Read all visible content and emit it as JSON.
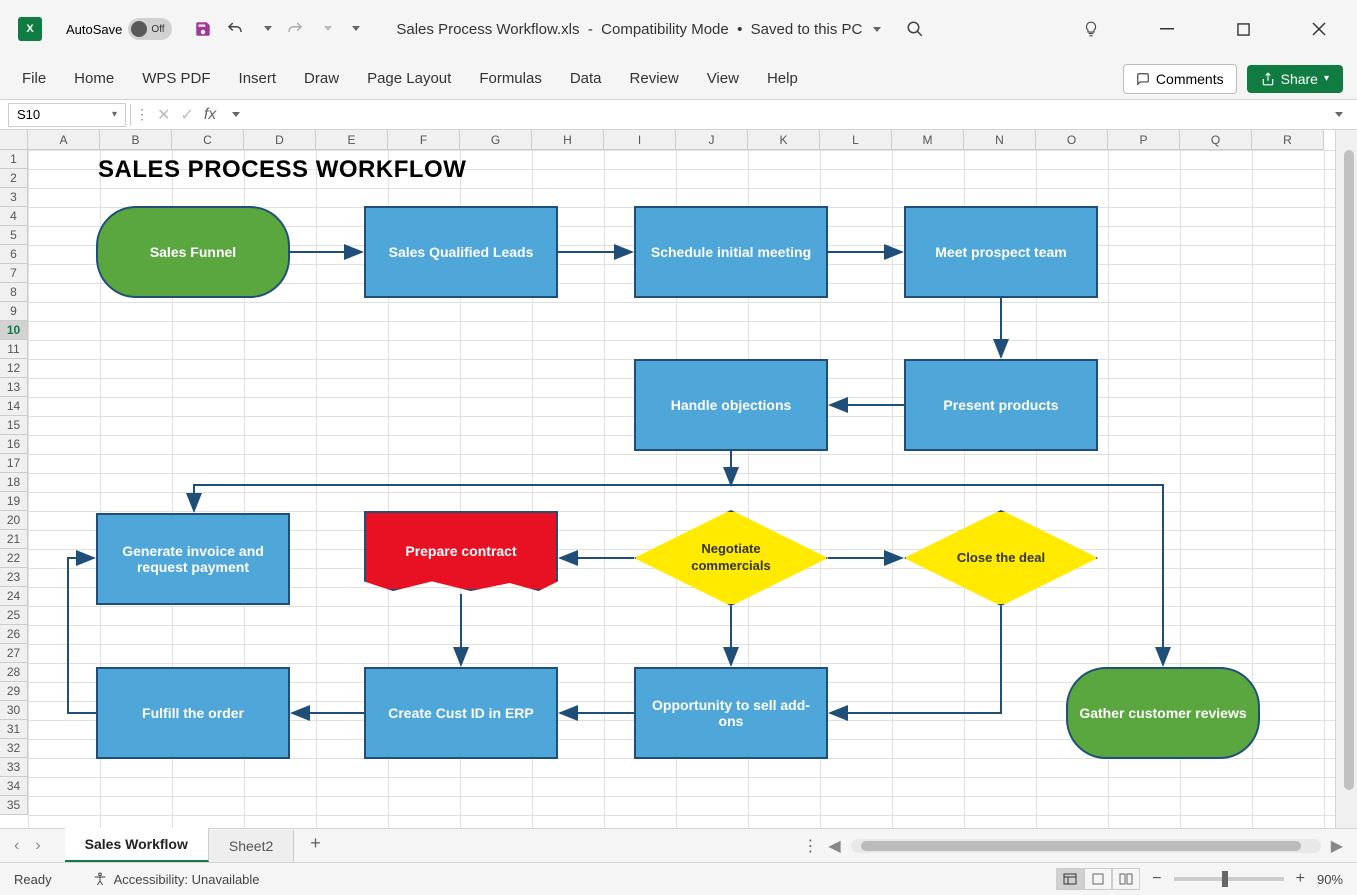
{
  "titlebar": {
    "autosave_label": "AutoSave",
    "autosave_state": "Off",
    "filename": "Sales Process Workflow.xls",
    "mode": "Compatibility Mode",
    "saved": "Saved to this PC"
  },
  "ribbon": {
    "tabs": [
      "File",
      "Home",
      "WPS PDF",
      "Insert",
      "Draw",
      "Page Layout",
      "Formulas",
      "Data",
      "Review",
      "View",
      "Help"
    ],
    "comments": "Comments",
    "share": "Share"
  },
  "formula_bar": {
    "cell_ref": "S10"
  },
  "columns": [
    "A",
    "B",
    "C",
    "D",
    "E",
    "F",
    "G",
    "H",
    "I",
    "J",
    "K",
    "L",
    "M",
    "N",
    "O",
    "P",
    "Q",
    "R"
  ],
  "rows_count": 35,
  "active_row": 10,
  "diagram": {
    "title": "SALES PROCESS WORKFLOW",
    "shapes": {
      "sales_funnel": "Sales Funnel",
      "sql": "Sales Qualified Leads",
      "schedule": "Schedule initial meeting",
      "meet": "Meet prospect team",
      "present": "Present products",
      "handle": "Handle objections",
      "negotiate": "Negotiate commercials",
      "close": "Close the deal",
      "contract": "Prepare contract",
      "invoice": "Generate invoice and request payment",
      "cust_id": "Create Cust ID in ERP",
      "addons": "Opportunity to sell add-ons",
      "fulfill": "Fulfill the order",
      "reviews": "Gather customer reviews"
    }
  },
  "sheets": {
    "active": "Sales Workflow",
    "other": "Sheet2"
  },
  "status": {
    "state": "Ready",
    "accessibility": "Accessibility: Unavailable",
    "zoom": "90%"
  },
  "chart_data": {
    "type": "flowchart",
    "title": "SALES PROCESS WORKFLOW",
    "nodes": [
      {
        "id": "sales_funnel",
        "label": "Sales Funnel",
        "type": "terminator"
      },
      {
        "id": "sql",
        "label": "Sales Qualified Leads",
        "type": "process"
      },
      {
        "id": "schedule",
        "label": "Schedule initial meeting",
        "type": "process"
      },
      {
        "id": "meet",
        "label": "Meet prospect team",
        "type": "process"
      },
      {
        "id": "present",
        "label": "Present products",
        "type": "process"
      },
      {
        "id": "handle",
        "label": "Handle objections",
        "type": "process"
      },
      {
        "id": "negotiate",
        "label": "Negotiate commercials",
        "type": "decision"
      },
      {
        "id": "close",
        "label": "Close the deal",
        "type": "decision"
      },
      {
        "id": "contract",
        "label": "Prepare contract",
        "type": "document"
      },
      {
        "id": "invoice",
        "label": "Generate invoice and request payment",
        "type": "process"
      },
      {
        "id": "cust_id",
        "label": "Create Cust ID in ERP",
        "type": "process"
      },
      {
        "id": "addons",
        "label": "Opportunity to sell add-ons",
        "type": "process"
      },
      {
        "id": "fulfill",
        "label": "Fulfill the order",
        "type": "process"
      },
      {
        "id": "reviews",
        "label": "Gather customer reviews",
        "type": "terminator"
      }
    ],
    "edges": [
      [
        "sales_funnel",
        "sql"
      ],
      [
        "sql",
        "schedule"
      ],
      [
        "schedule",
        "meet"
      ],
      [
        "meet",
        "present"
      ],
      [
        "present",
        "handle"
      ],
      [
        "handle",
        "negotiate"
      ],
      [
        "handle",
        "close"
      ],
      [
        "handle",
        "reviews"
      ],
      [
        "handle",
        "invoice"
      ],
      [
        "negotiate",
        "contract"
      ],
      [
        "negotiate",
        "addons"
      ],
      [
        "close",
        "addons"
      ],
      [
        "contract",
        "cust_id"
      ],
      [
        "cust_id",
        "fulfill"
      ],
      [
        "addons",
        "cust_id"
      ],
      [
        "fulfill",
        "invoice"
      ]
    ]
  }
}
